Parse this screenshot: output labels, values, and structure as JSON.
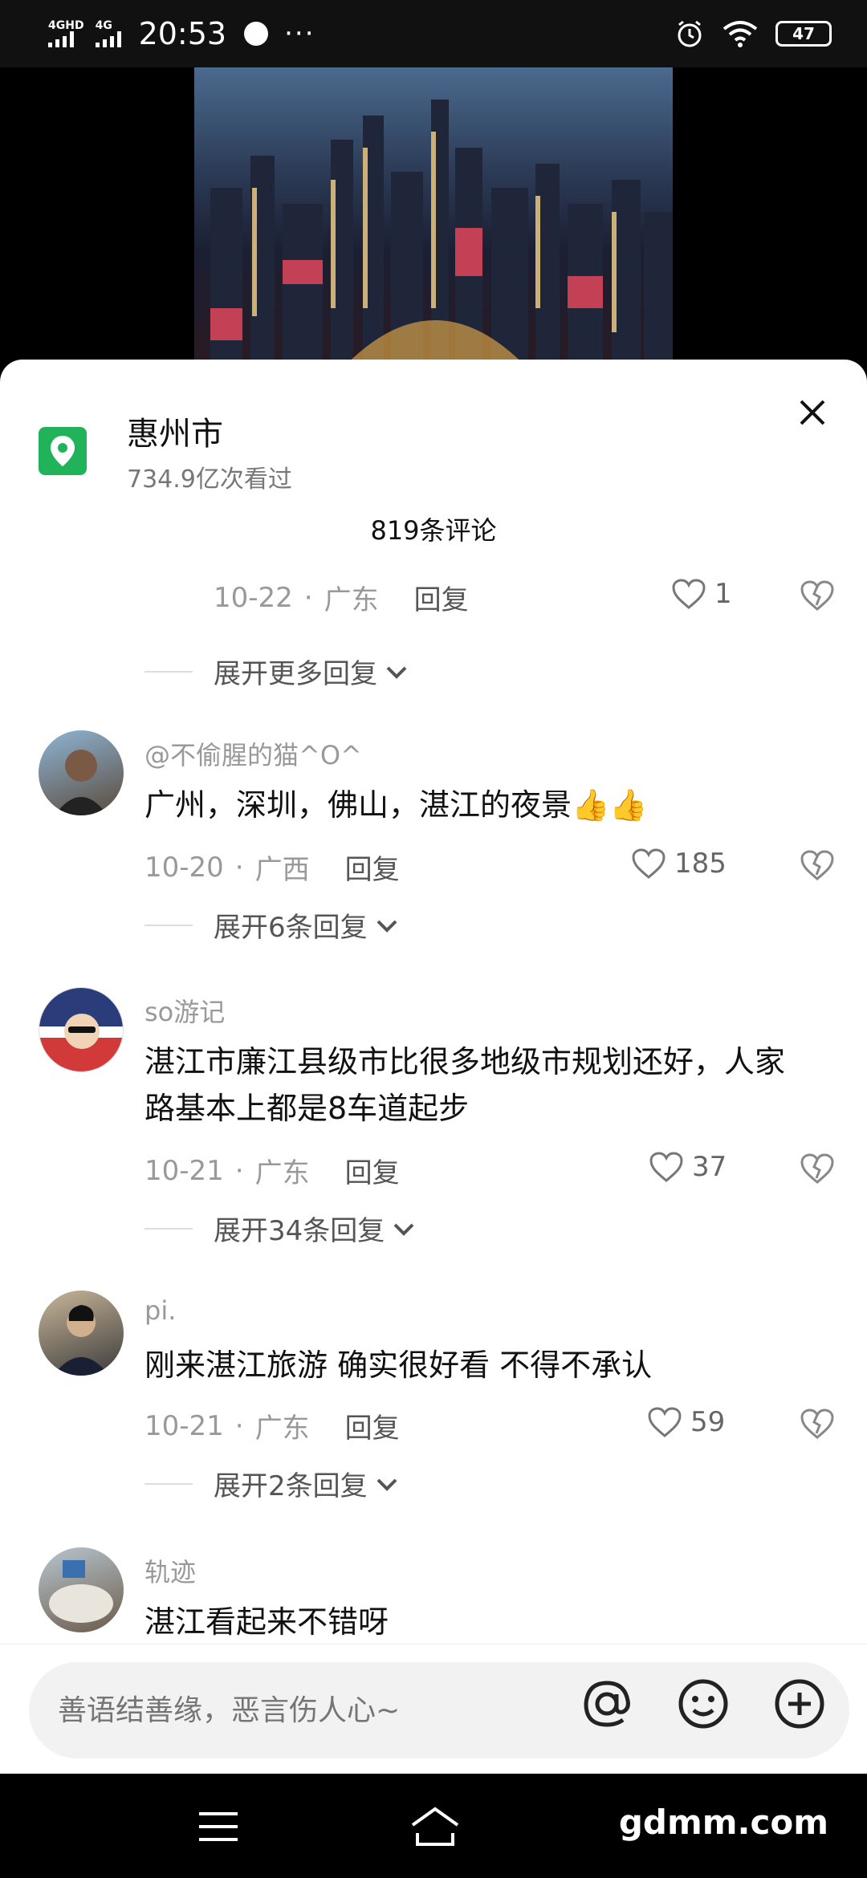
{
  "status_bar": {
    "network_1": "4GHD",
    "network_2": "4G",
    "time": "20:53",
    "more": "···",
    "battery": "47"
  },
  "location": {
    "title": "惠州市",
    "views": "734.9亿次看过"
  },
  "comments_count": "819条评论",
  "reply_row_top": {
    "meta_date": "10-22",
    "meta_region": "广东",
    "reply_label": "回复",
    "likes": "1"
  },
  "expand_top": "展开更多回复",
  "comments": [
    {
      "username": "@不偷腥的猫^O^",
      "text": "广州，深圳，佛山，湛江的夜景👍👍",
      "date": "10-20",
      "region": "广西",
      "reply_label": "回复",
      "likes": "185",
      "expand": "展开6条回复"
    },
    {
      "username": "so游记",
      "text": "湛江市廉江县级市比很多地级市规划还好，人家路基本上都是8车道起步",
      "date": "10-21",
      "region": "广东",
      "reply_label": "回复",
      "likes": "37",
      "expand": "展开34条回复"
    },
    {
      "username": "pi.",
      "text": "刚来湛江旅游  确实很好看  不得不承认",
      "date": "10-21",
      "region": "广东",
      "reply_label": "回复",
      "likes": "59",
      "expand": "展开2条回复"
    },
    {
      "username": "轨迹",
      "text": "湛江看起来不错呀"
    }
  ],
  "input": {
    "placeholder": "善语结善缘，恶言伤人心~"
  },
  "nav": {
    "watermark": "gdmm.com"
  },
  "colors": {
    "accent_green": "#21b35a",
    "sheet_bg": "#ffffff"
  }
}
